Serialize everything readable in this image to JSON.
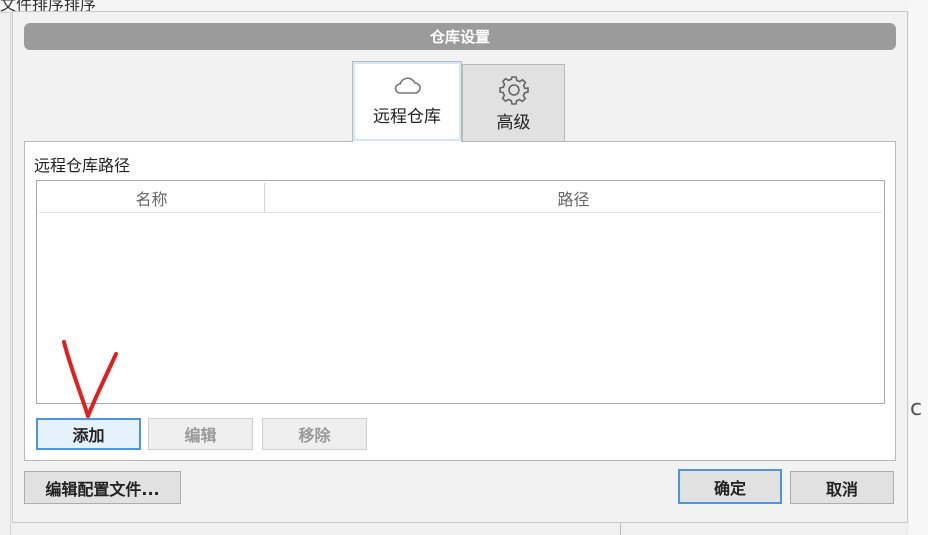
{
  "background": {
    "top_text": "文件排序排序",
    "right_text": "c"
  },
  "dialog": {
    "title": "仓库设置",
    "tabs": [
      {
        "label": "远程仓库",
        "icon": "cloud-icon",
        "active": true
      },
      {
        "label": "高级",
        "icon": "gear-icon",
        "active": false
      }
    ],
    "panel_label": "远程仓库路径",
    "table": {
      "columns": [
        "名称",
        "路径"
      ],
      "rows": []
    },
    "buttons": {
      "add": "添加",
      "edit": "编辑",
      "remove": "移除",
      "edit_config": "编辑配置文件...",
      "ok": "确定",
      "cancel": "取消"
    },
    "colors": {
      "title_bg": "#9b9b9b",
      "focus_border": "#4a97e0",
      "annotation": "#e02020"
    }
  }
}
